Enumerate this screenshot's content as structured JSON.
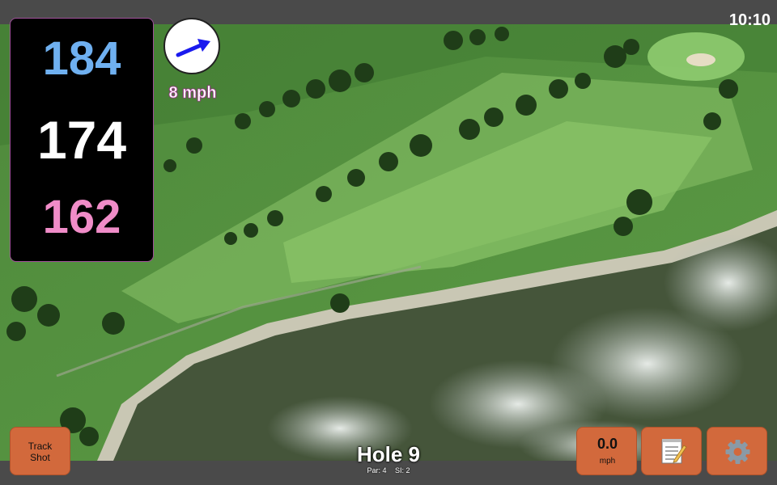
{
  "status": {
    "time": "10:10"
  },
  "distances": {
    "back": "184",
    "middle": "174",
    "front": "162",
    "colors": {
      "back": "#6fb0f0",
      "middle": "#ffffff",
      "front": "#f08cc8"
    }
  },
  "wind": {
    "speed_text": "8 mph",
    "arrow_icon": "wind-direction-arrow-icon"
  },
  "buttons": {
    "track_shot": {
      "line1": "Track",
      "line2": "Shot"
    },
    "speed": {
      "value": "0.0",
      "unit": "mph"
    },
    "notes_icon": "notepad-icon",
    "settings_icon": "gear-icon",
    "accent": "#d2693c"
  },
  "hole": {
    "title": "Hole 9",
    "par": "Par: 4",
    "si": "SI: 2"
  }
}
